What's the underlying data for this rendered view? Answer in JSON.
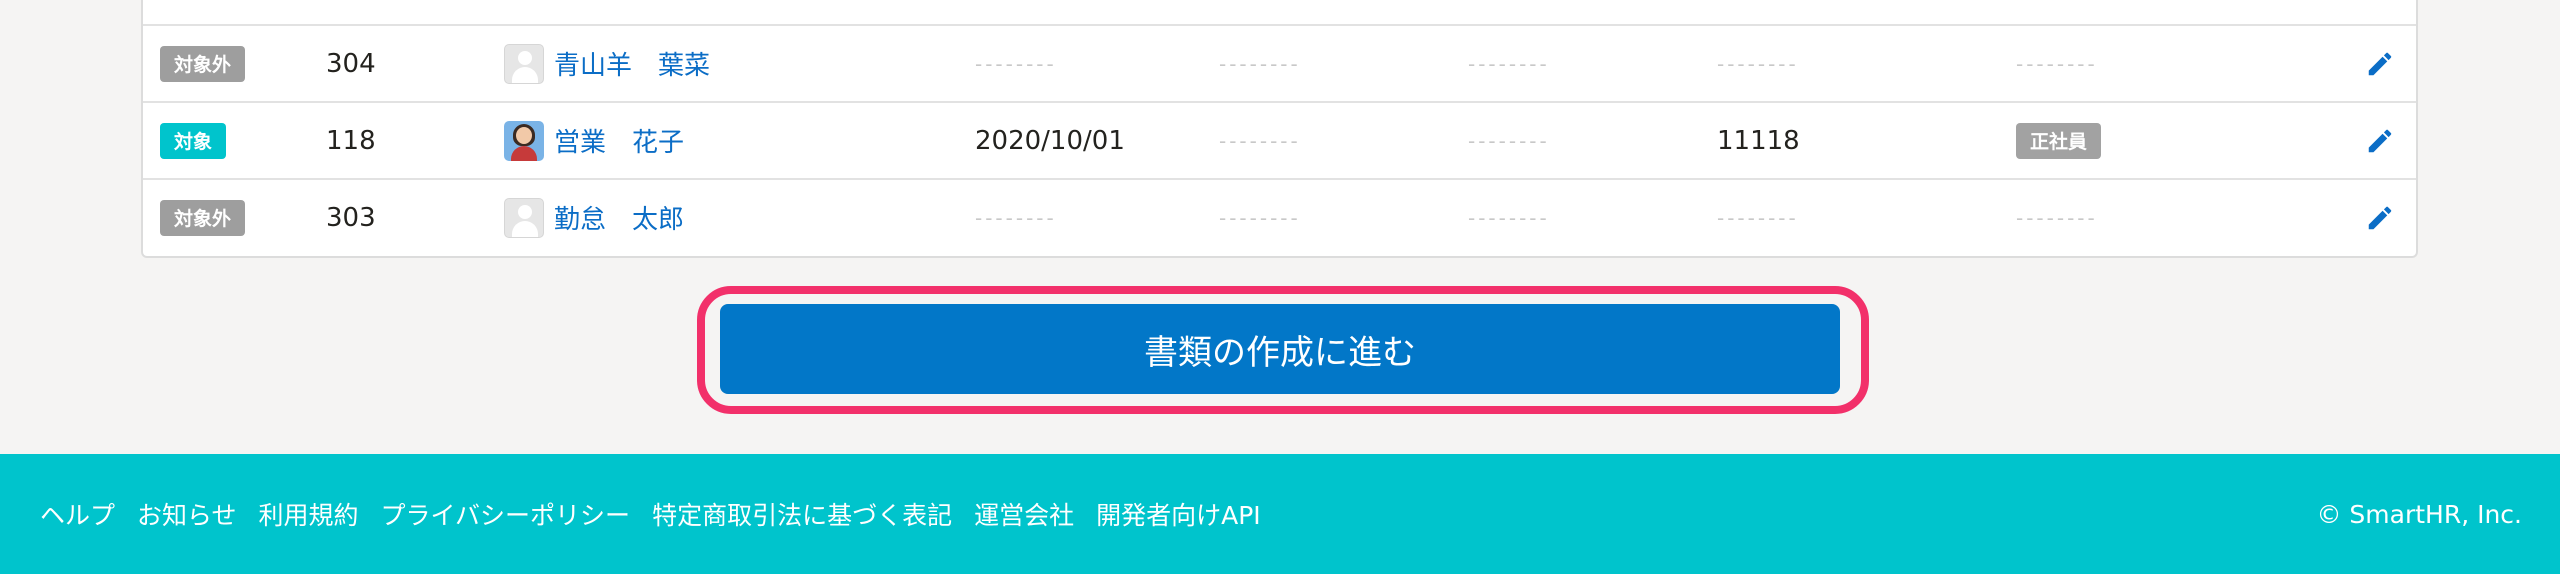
{
  "rows": [
    {
      "status": "対象外",
      "status_type": "out",
      "number": "304",
      "name": "青山羊　葉菜",
      "avatar": "blank",
      "date": "--------",
      "col5": "--------",
      "col6": "--------",
      "code": "--------",
      "type": "--------"
    },
    {
      "status": "対象",
      "status_type": "in",
      "number": "118",
      "name": "営業　花子",
      "avatar": "photo",
      "date": "2020/10/01",
      "col5": "--------",
      "col6": "--------",
      "code": "11118",
      "type": "正社員"
    },
    {
      "status": "対象外",
      "status_type": "out",
      "number": "303",
      "name": "勤怠　太郎",
      "avatar": "blank",
      "date": "--------",
      "col5": "--------",
      "col6": "--------",
      "code": "--------",
      "type": "--------"
    }
  ],
  "cta": {
    "label": "書類の作成に進む"
  },
  "footer": {
    "links": [
      "ヘルプ",
      "お知らせ",
      "利用規約",
      "プライバシーポリシー",
      "特定商取引法に基づく表記",
      "運営会社",
      "開発者向けAPI"
    ],
    "copyright": "© SmartHR, Inc."
  },
  "colors": {
    "accent": "#0277c8",
    "highlight": "#f2306a",
    "footer_bg": "#00c4cc",
    "link": "#0b6dc6"
  },
  "icons": {
    "edit": "pencil-icon"
  }
}
